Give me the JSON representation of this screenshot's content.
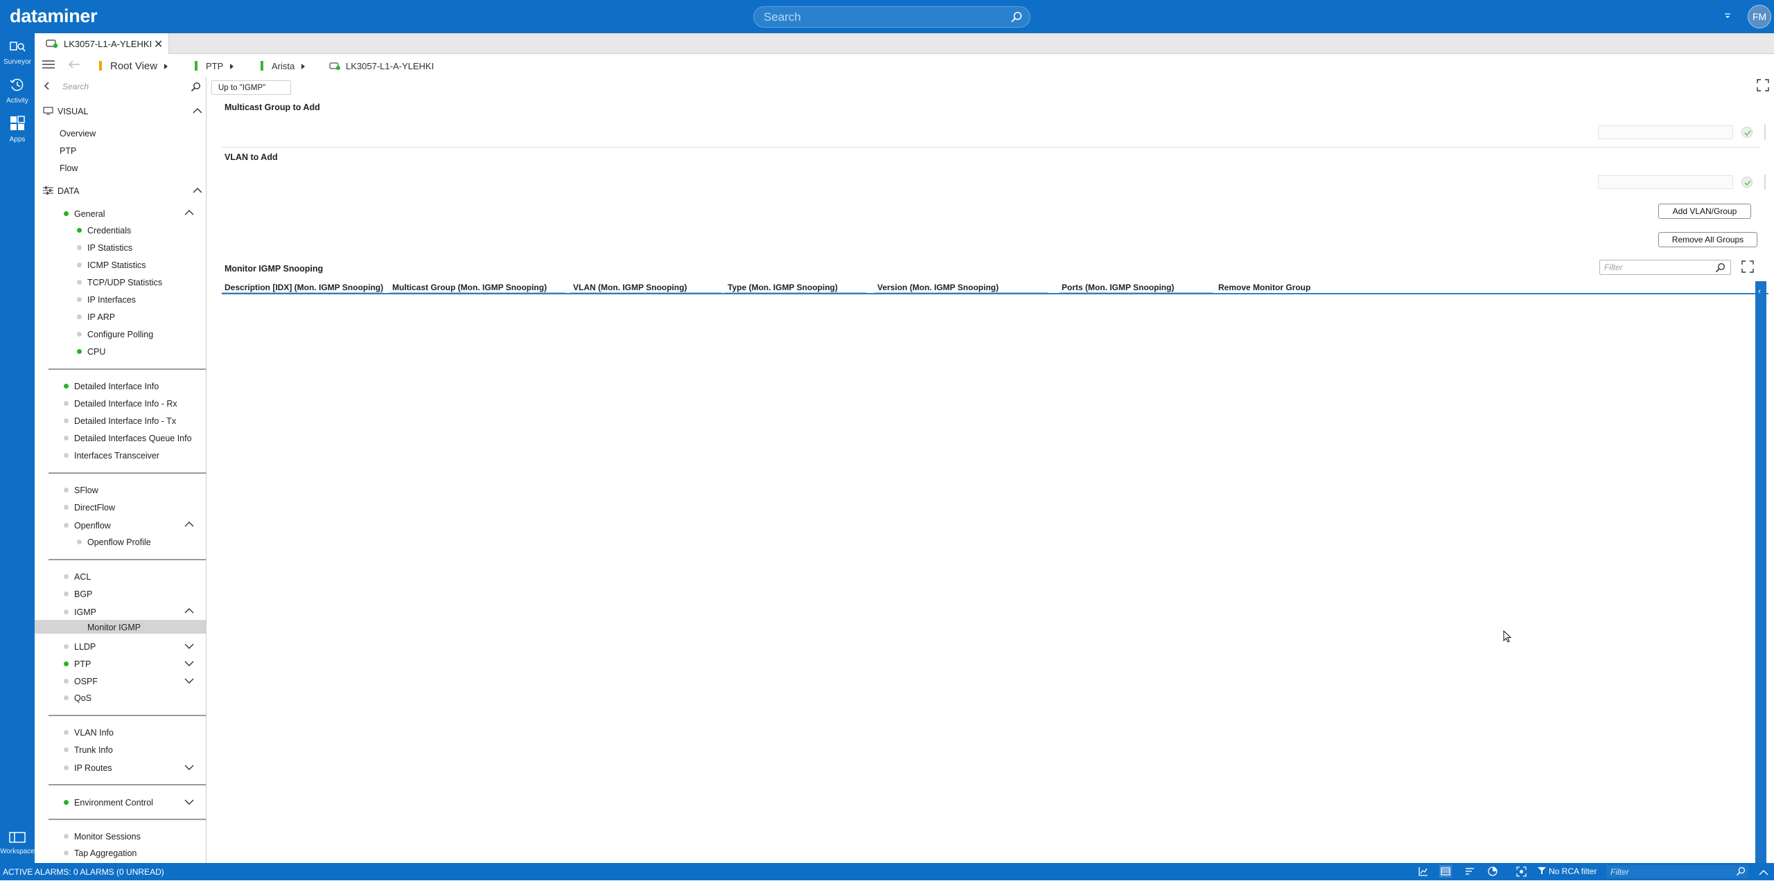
{
  "app": {
    "brand": "dataminer"
  },
  "header": {
    "search_placeholder": "Search",
    "user_initials": "FM"
  },
  "rail": {
    "items": [
      {
        "label": "Surveyor"
      },
      {
        "label": "Activity"
      },
      {
        "label": "Apps"
      },
      {
        "label": "Workspace"
      }
    ]
  },
  "tab": {
    "title": "LK3057-L1-A-YLEHKI"
  },
  "breadcrumb": {
    "items": [
      "Root View",
      "PTP",
      "Arista",
      "LK3057-L1-A-YLEHKI"
    ]
  },
  "nav": {
    "search_placeholder": "Search",
    "visual_header": "VISUAL",
    "visual_items": [
      "Overview",
      "PTP",
      "Flow"
    ],
    "data_header": "DATA",
    "general": "General",
    "general_items": [
      "Credentials",
      "IP Statistics",
      "ICMP Statistics",
      "TCP/UDP Statistics",
      "IP Interfaces",
      "IP ARP",
      "Configure Polling",
      "CPU"
    ],
    "interface_items": [
      "Detailed Interface Info",
      "Detailed Interface Info - Rx",
      "Detailed Interface Info - Tx",
      "Detailed Interfaces Queue Info",
      "Interfaces Transceiver"
    ],
    "flow_items": [
      "SFlow",
      "DirectFlow",
      "Openflow"
    ],
    "openflow_sub": "Openflow Profile",
    "protocol_items": [
      "ACL",
      "BGP",
      "IGMP"
    ],
    "igmp_sub": "Monitor IGMP",
    "protocol_items2": [
      "LLDP",
      "PTP",
      "OSPF",
      "QoS"
    ],
    "vlan_items": [
      "VLAN Info",
      "Trunk Info",
      "IP Routes"
    ],
    "env": "Environment Control",
    "misc_items": [
      "Monitor Sessions",
      "Tap Aggregation"
    ]
  },
  "main": {
    "up_button": "Up to \"IGMP\"",
    "multicast_title": "Multicast Group to Add",
    "vlan_title": "VLAN to Add",
    "add_button": "Add VLAN/Group",
    "remove_button": "Remove All Groups",
    "table_title": "Monitor IGMP Snooping",
    "filter_placeholder": "Filter",
    "columns": [
      "Description [IDX] (Mon. IGMP Snooping)",
      "Multicast Group (Mon. IGMP Snooping)",
      "VLAN (Mon. IGMP Snooping)",
      "Type (Mon. IGMP Snooping)",
      "Version (Mon. IGMP Snooping)",
      "Ports (Mon. IGMP Snooping)",
      "Remove Monitor Group"
    ],
    "rows": []
  },
  "statusbar": {
    "alarms": "ACTIVE ALARMS: 0 ALARMS (0 UNREAD)",
    "rca": "No RCA filter",
    "filter_placeholder": "Filter"
  },
  "colors": {
    "brand_blue": "#0f6fc6",
    "status_green": "#27b327",
    "status_grey": "#cfcfcf",
    "table_accent": "#2a7fcf"
  },
  "icons": [
    "search-icon",
    "surveyor-icon",
    "activity-icon",
    "apps-icon",
    "workspace-icon",
    "card-icon",
    "close-icon",
    "menu-icon",
    "back-arrow-icon",
    "chevron-up-icon",
    "chevron-down-icon",
    "fullscreen-icon",
    "check-icon",
    "trend-icon",
    "filter-icon"
  ]
}
